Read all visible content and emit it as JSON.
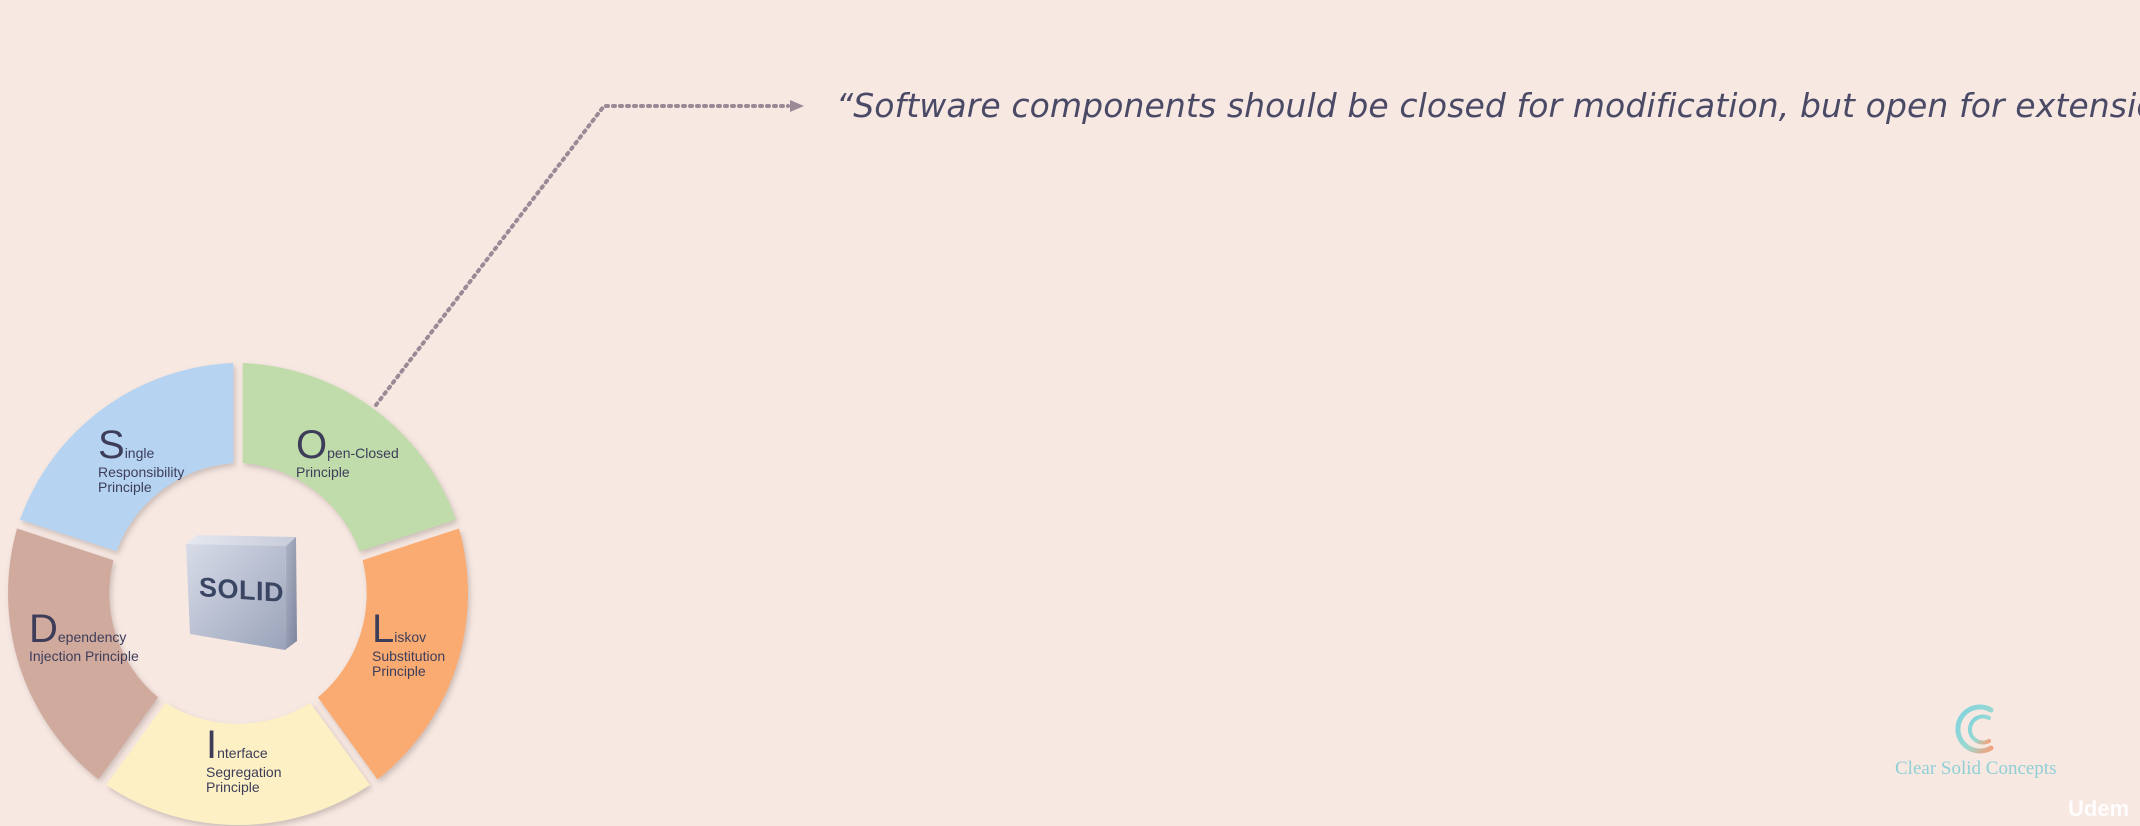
{
  "quote": "“Software components should be closed for modification, but open for extension”",
  "center_label": "SOLID",
  "segments": [
    {
      "initial": "S",
      "rest": "ingle",
      "sub1": "Responsibility",
      "sub2": "Principle",
      "color": "#b6d4f2"
    },
    {
      "initial": "O",
      "rest": "pen-Closed",
      "sub1": "Principle",
      "sub2": "",
      "color": "#bfdcaa"
    },
    {
      "initial": "L",
      "rest": "iskov",
      "sub1": "Substitution",
      "sub2": "Principle",
      "color": "#f9ab72"
    },
    {
      "initial": "I",
      "rest": "nterface",
      "sub1": "Segregation",
      "sub2": "Principle",
      "color": "#fdf0c4"
    },
    {
      "initial": "D",
      "rest": "ependency",
      "sub1": "Injection Principle",
      "sub2": "",
      "color": "#d1aa9e"
    }
  ],
  "logo": {
    "caption": "Clear Solid Concepts"
  },
  "watermark": "Udem",
  "colors": {
    "background": "#f7e8e2",
    "text": "#4a4a66",
    "connector": "#9a8a96"
  }
}
